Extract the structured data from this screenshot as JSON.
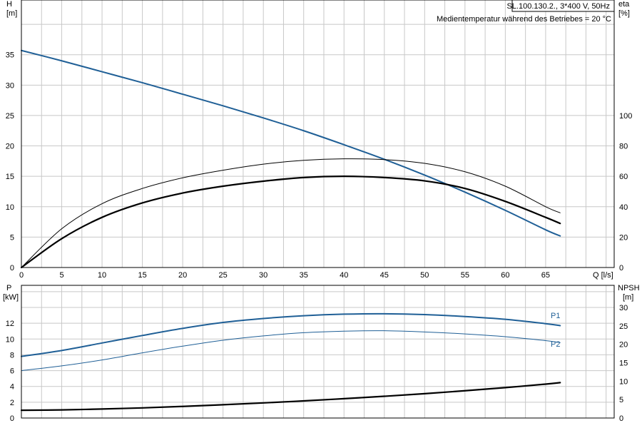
{
  "chart_data": [
    {
      "type": "line",
      "panel": "upper",
      "title": "SL.100.130.2., 3*400 V, 50Hz",
      "subtitle": "Medientemperatur während des Betriebes = 20 °C",
      "xlabel": "Q [l/s]",
      "ylabel_left": [
        "H",
        "[m]"
      ],
      "ylabel_right": [
        "eta",
        "[%]"
      ],
      "xlim": [
        0,
        73.5
      ],
      "ylim_left": [
        0,
        44
      ],
      "ylim_right": [
        0,
        176
      ],
      "x_ticks": [
        0,
        5,
        10,
        15,
        20,
        25,
        30,
        35,
        40,
        45,
        50,
        55,
        60,
        65
      ],
      "y_ticks_left": [
        0,
        5,
        10,
        15,
        20,
        25,
        30,
        35
      ],
      "y_ticks_right": [
        0,
        20,
        40,
        60,
        80,
        100
      ],
      "grid": true,
      "series": [
        {
          "axis": "left",
          "color": "#1f5f96",
          "width": 2,
          "x": [
            0,
            5,
            10,
            15,
            20,
            25,
            30,
            35,
            40,
            45,
            50,
            55,
            60,
            65,
            66.8
          ],
          "y": [
            35.7,
            34.0,
            32.2,
            30.4,
            28.5,
            26.6,
            24.6,
            22.5,
            20.2,
            17.8,
            15.2,
            12.4,
            9.4,
            6.2,
            5.2
          ]
        },
        {
          "axis": "right",
          "color": "#000000",
          "width": 1,
          "x": [
            0,
            5,
            10,
            15,
            20,
            25,
            30,
            35,
            40,
            45,
            50,
            55,
            60,
            65,
            66.8
          ],
          "y": [
            0,
            25.5,
            42,
            52,
            59,
            64,
            68,
            70.5,
            71.5,
            71,
            68.5,
            63,
            53.5,
            40,
            36
          ]
        },
        {
          "axis": "right",
          "color": "#000000",
          "width": 2.2,
          "x": [
            0,
            5,
            10,
            15,
            20,
            25,
            30,
            35,
            40,
            45,
            50,
            55,
            60,
            65,
            66.8
          ],
          "y": [
            0,
            19,
            33,
            42.5,
            49,
            53.5,
            56.8,
            59.2,
            60,
            59.2,
            57,
            52,
            43.5,
            33,
            29
          ]
        }
      ]
    },
    {
      "type": "line",
      "panel": "lower",
      "ylabel_left": [
        "P",
        "[kW]"
      ],
      "ylabel_right": [
        "NPSH",
        "[m]"
      ],
      "xlim": [
        0,
        73.5
      ],
      "ylim_left": [
        0,
        16.8
      ],
      "ylim_right": [
        0,
        36
      ],
      "y_ticks_left": [
        0,
        2,
        4,
        6,
        8,
        10,
        12
      ],
      "y_ticks_right": [
        0,
        5,
        10,
        15,
        20,
        25,
        30
      ],
      "grid": true,
      "series": [
        {
          "name": "P1",
          "axis": "left",
          "color": "#1f5f96",
          "width": 2,
          "x": [
            0,
            5,
            10,
            15,
            20,
            25,
            30,
            35,
            40,
            45,
            50,
            55,
            60,
            65,
            66.8
          ],
          "y": [
            7.8,
            8.55,
            9.5,
            10.45,
            11.35,
            12.1,
            12.6,
            12.95,
            13.15,
            13.2,
            13.1,
            12.85,
            12.5,
            11.95,
            11.7
          ]
        },
        {
          "name": "P2",
          "axis": "left",
          "color": "#1f5f96",
          "width": 1,
          "x": [
            0,
            5,
            10,
            15,
            20,
            25,
            30,
            35,
            40,
            45,
            50,
            55,
            60,
            65,
            66.8
          ],
          "y": [
            6.0,
            6.6,
            7.35,
            8.25,
            9.1,
            9.85,
            10.4,
            10.8,
            11.0,
            11.05,
            10.9,
            10.65,
            10.3,
            9.8,
            9.55
          ]
        },
        {
          "axis": "right",
          "color": "#000000",
          "width": 2.2,
          "x": [
            0,
            5,
            10,
            15,
            20,
            25,
            30,
            35,
            40,
            45,
            50,
            55,
            60,
            65,
            66.8
          ],
          "y": [
            2.1,
            2.2,
            2.45,
            2.75,
            3.15,
            3.6,
            4.1,
            4.65,
            5.25,
            5.9,
            6.6,
            7.4,
            8.25,
            9.2,
            9.6
          ]
        }
      ]
    }
  ]
}
